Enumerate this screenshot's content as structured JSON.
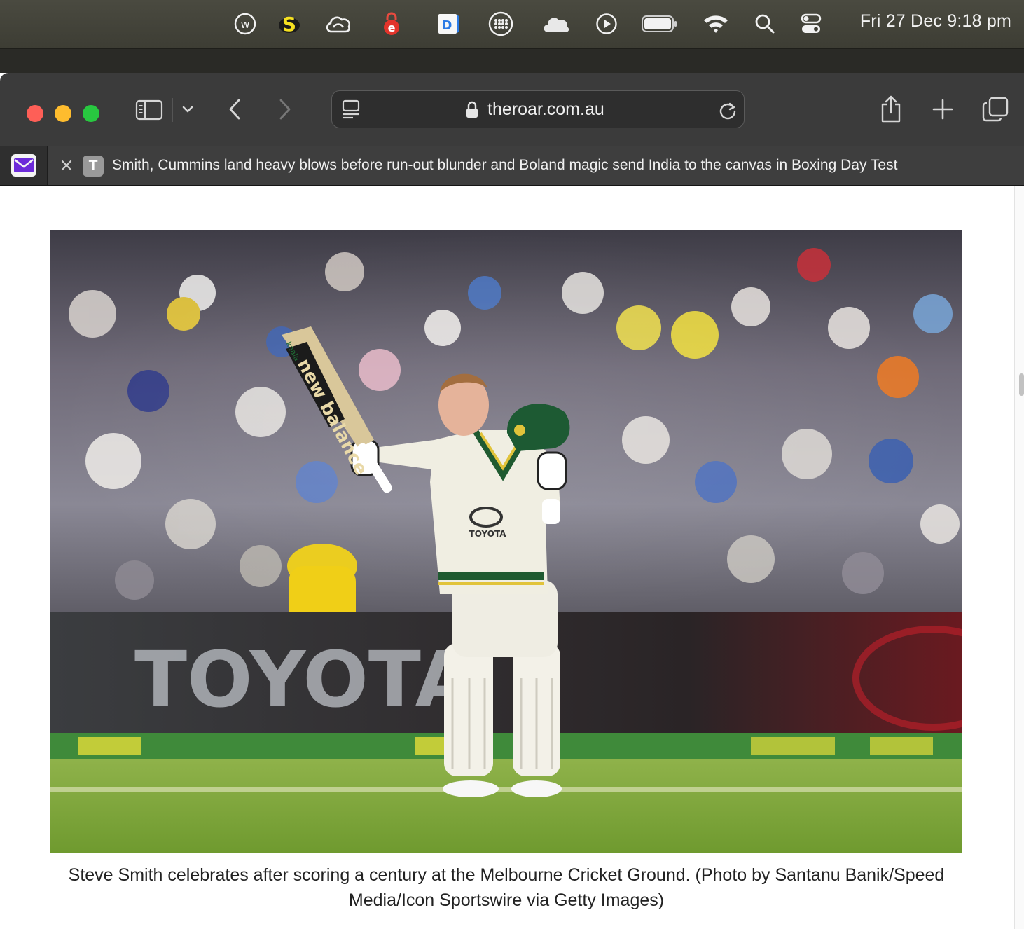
{
  "menubar": {
    "icons": [
      "w-circle-icon",
      "s-coin-icon",
      "creative-cloud-icon",
      "e-lock-icon",
      "d-document-icon",
      "grid-dots-icon",
      "cloud-icon",
      "play-circle-icon",
      "battery-icon",
      "wifi-icon",
      "search-icon",
      "control-center-icon"
    ],
    "clock": "Fri 27 Dec  9:18 pm"
  },
  "toolbar": {
    "url": "theroar.com.au"
  },
  "tabs": {
    "pinned_icon": "mail-icon",
    "active_favicon_letter": "T",
    "active_title": "Smith, Cummins land heavy blows before run-out blunder and Boland magic send India to the canvas in Boxing Day Test"
  },
  "article": {
    "photo_bat_brand": "new balance",
    "photo_bat_sticker": "kaala",
    "photo_shirt_sponsor": "TOYOTA",
    "photo_signage": "TOYOTA",
    "caption": "Steve Smith celebrates after scoring a century at the Melbourne Cricket Ground. (Photo by Santanu Banik/Speed Media/Icon Sportswire via Getty Images)"
  },
  "colors": {
    "menubar_bg": "#4a4a40",
    "toolbar_bg": "#3b3b3b",
    "tab_active_bg": "#3e3e3e",
    "traffic_red": "#fe5f57",
    "traffic_yellow": "#febc2e",
    "traffic_green": "#28c840",
    "pinned_tab_purple": "#6c2bd9"
  }
}
